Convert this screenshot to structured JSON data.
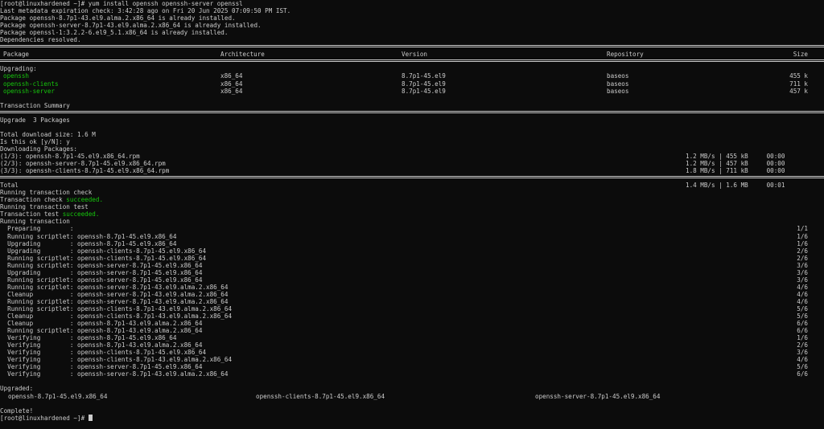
{
  "preamble": [
    "[root@linuxhardened ~]# yum install openssh openssh-server openssl",
    "Last metadata expiration check: 3:42:28 ago on Fri 20 Jun 2025 07:09:50 PM IST.",
    "Package openssh-8.7p1-43.el9.alma.2.x86_64 is already installed.",
    "Package openssh-server-8.7p1-43.el9.alma.2.x86_64 is already installed.",
    "Package openssl-1:3.2.2-6.el9_5.1.x86_64 is already installed.",
    "Dependencies resolved."
  ],
  "table": {
    "headers": {
      "package": "Package",
      "arch": "Architecture",
      "version": "Version",
      "repo": "Repository",
      "size": "Size"
    },
    "section_label": "Upgrading:",
    "rows": [
      {
        "package": "openssh",
        "arch": "x86_64",
        "version": "8.7p1-45.el9",
        "repo": "baseos",
        "size": "455 k"
      },
      {
        "package": "openssh-clients",
        "arch": "x86_64",
        "version": "8.7p1-45.el9",
        "repo": "baseos",
        "size": "711 k"
      },
      {
        "package": "openssh-server",
        "arch": "x86_64",
        "version": "8.7p1-45.el9",
        "repo": "baseos",
        "size": "457 k"
      }
    ]
  },
  "summary": {
    "title": "Transaction Summary",
    "upgrade": "Upgrade  3 Packages"
  },
  "download": {
    "total_size": "Total download size: 1.6 M",
    "prompt": "Is this ok [y/N]: y",
    "label": "Downloading Packages:",
    "items": [
      {
        "name": "(1/3): openssh-8.7p1-45.el9.x86_64.rpm",
        "stats": "1.2 MB/s | 455 kB     00:00"
      },
      {
        "name": "(2/3): openssh-server-8.7p1-45.el9.x86_64.rpm",
        "stats": "1.2 MB/s | 457 kB     00:00"
      },
      {
        "name": "(3/3): openssh-clients-8.7p1-45.el9.x86_64.rpm",
        "stats": "1.8 MB/s | 711 kB     00:00"
      }
    ],
    "total_label": "Total",
    "total_stats": "1.4 MB/s | 1.6 MB     00:01"
  },
  "transaction": {
    "check_running": "Running transaction check",
    "check_prefix": "Transaction check ",
    "check_status": "succeeded.",
    "test_running": "Running transaction test",
    "test_prefix": "Transaction test ",
    "test_status": "succeeded.",
    "running": "Running transaction",
    "steps": [
      {
        "text": "  Preparing        :",
        "count": "1/1"
      },
      {
        "text": "  Running scriptlet: openssh-8.7p1-45.el9.x86_64",
        "count": "1/6"
      },
      {
        "text": "  Upgrading        : openssh-8.7p1-45.el9.x86_64",
        "count": "1/6"
      },
      {
        "text": "  Upgrading        : openssh-clients-8.7p1-45.el9.x86_64",
        "count": "2/6"
      },
      {
        "text": "  Running scriptlet: openssh-clients-8.7p1-45.el9.x86_64",
        "count": "2/6"
      },
      {
        "text": "  Running scriptlet: openssh-server-8.7p1-45.el9.x86_64",
        "count": "3/6"
      },
      {
        "text": "  Upgrading        : openssh-server-8.7p1-45.el9.x86_64",
        "count": "3/6"
      },
      {
        "text": "  Running scriptlet: openssh-server-8.7p1-45.el9.x86_64",
        "count": "3/6"
      },
      {
        "text": "  Running scriptlet: openssh-server-8.7p1-43.el9.alma.2.x86_64",
        "count": "4/6"
      },
      {
        "text": "  Cleanup          : openssh-server-8.7p1-43.el9.alma.2.x86_64",
        "count": "4/6"
      },
      {
        "text": "  Running scriptlet: openssh-server-8.7p1-43.el9.alma.2.x86_64",
        "count": "4/6"
      },
      {
        "text": "  Running scriptlet: openssh-clients-8.7p1-43.el9.alma.2.x86_64",
        "count": "5/6"
      },
      {
        "text": "  Cleanup          : openssh-clients-8.7p1-43.el9.alma.2.x86_64",
        "count": "5/6"
      },
      {
        "text": "  Cleanup          : openssh-8.7p1-43.el9.alma.2.x86_64",
        "count": "6/6"
      },
      {
        "text": "  Running scriptlet: openssh-8.7p1-43.el9.alma.2.x86_64",
        "count": "6/6"
      },
      {
        "text": "  Verifying        : openssh-8.7p1-45.el9.x86_64",
        "count": "1/6"
      },
      {
        "text": "  Verifying        : openssh-8.7p1-43.el9.alma.2.x86_64",
        "count": "2/6"
      },
      {
        "text": "  Verifying        : openssh-clients-8.7p1-45.el9.x86_64",
        "count": "3/6"
      },
      {
        "text": "  Verifying        : openssh-clients-8.7p1-43.el9.alma.2.x86_64",
        "count": "4/6"
      },
      {
        "text": "  Verifying        : openssh-server-8.7p1-45.el9.x86_64",
        "count": "5/6"
      },
      {
        "text": "  Verifying        : openssh-server-8.7p1-43.el9.alma.2.x86_64",
        "count": "6/6"
      }
    ]
  },
  "upgraded": {
    "label": "Upgraded:",
    "packages": [
      "openssh-8.7p1-45.el9.x86_64",
      "openssh-clients-8.7p1-45.el9.x86_64",
      "openssh-server-8.7p1-45.el9.x86_64"
    ]
  },
  "complete": "Complete!",
  "final_prompt": "[root@linuxhardened ~]# ",
  "colors": {
    "background": "#0c0c0c",
    "text": "#cccccc",
    "success": "#16c60c"
  }
}
